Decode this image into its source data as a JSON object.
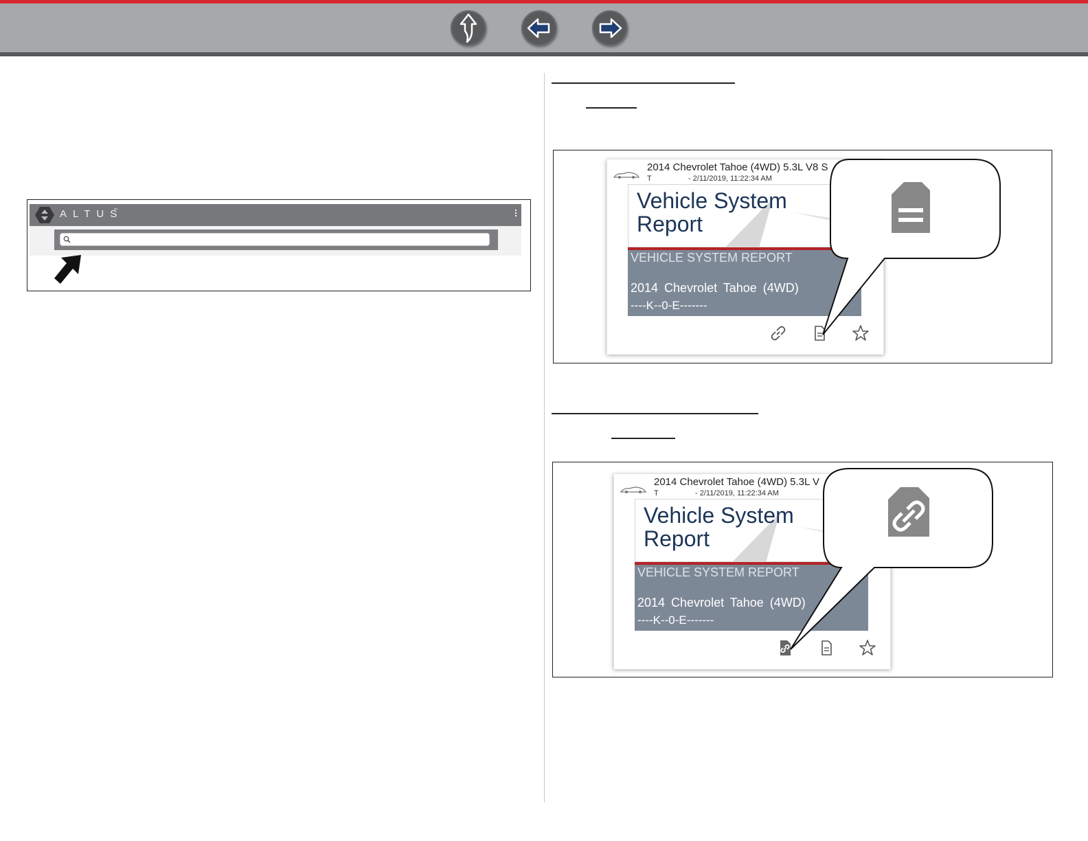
{
  "nav": {
    "up_label": "Up",
    "back_label": "Back",
    "forward_label": "Forward"
  },
  "altus": {
    "brand": "ALTUS",
    "trademark": "™",
    "search_value": ""
  },
  "card1": {
    "title": "2014 Chevrolet Tahoe (4WD) 5.3L V8 S",
    "tech": "T",
    "date": "- 2/11/2019, 11:22:34 AM",
    "report_heading": "Vehicle System Report",
    "report_caps": "VEHICLE SYSTEM REPORT",
    "model": "2014 Chevrolet Tahoe (4WD)",
    "vin": "----K--0-E-------"
  },
  "card2": {
    "title": "2014 Chevrolet Tahoe (4WD) 5.3L V",
    "tech": "T",
    "date": "- 2/11/2019, 11:22:34 AM",
    "report_heading": "Vehicle System Report",
    "report_caps": "VEHICLE SYSTEM REPORT",
    "model": "2014 Chevrolet Tahoe (4WD)",
    "vin": "----K--0-E-------"
  },
  "icons": {
    "up": "up-arrow-icon",
    "back": "left-arrow-icon",
    "forward": "right-arrow-icon",
    "link": "link-icon",
    "document": "document-icon",
    "shared_link": "shared-link-icon",
    "favorite": "star-icon"
  },
  "colors": {
    "accent_red": "#d7262d",
    "toolbar_gray": "#a7a8aa",
    "button_dark": "#58595b",
    "report_navy": "#1b3556",
    "report_band": "#7d8897"
  }
}
